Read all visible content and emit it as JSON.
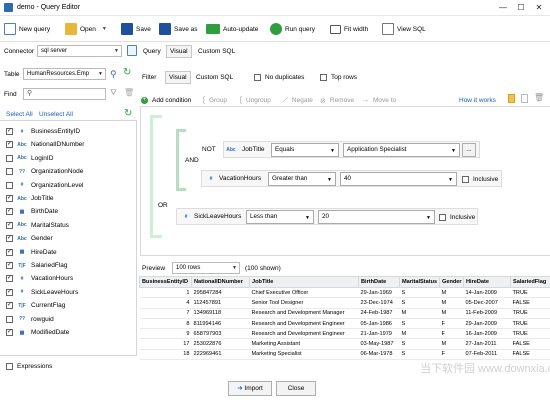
{
  "window": {
    "title": "demo - Query Editor",
    "controls": [
      "—",
      "☐",
      "✕"
    ]
  },
  "toolbar": {
    "new_query": "New query",
    "open": "Open",
    "save": "Save",
    "save_as": "Save as",
    "auto_update": "Auto-update",
    "run_query": "Run query",
    "fit_width": "Fit width",
    "view_sql": "View SQL"
  },
  "connector": {
    "label": "Connector",
    "value": "sql server",
    "query_label": "Query",
    "tabs": [
      "Visual",
      "Custom SQL"
    ]
  },
  "table": {
    "label": "Table",
    "value": "HumanResources.Emp",
    "find_label": "Find",
    "find_value": "",
    "select_all": "Select All",
    "unselect_all": "Unselect All"
  },
  "fields": [
    {
      "type": "#",
      "name": "BusinessEntityID",
      "checked": true
    },
    {
      "type": "Abc",
      "name": "NationalIDNumber",
      "checked": true
    },
    {
      "type": "Abc",
      "name": "LoginID",
      "checked": false
    },
    {
      "type": "??",
      "name": "OrganizationNode",
      "checked": false
    },
    {
      "type": "#",
      "name": "OrganizationLevel",
      "checked": false
    },
    {
      "type": "Abc",
      "name": "JobTitle",
      "checked": true
    },
    {
      "type": "▦",
      "name": "BirthDate",
      "checked": true
    },
    {
      "type": "Abc",
      "name": "MaritalStatus",
      "checked": true
    },
    {
      "type": "Abc",
      "name": "Gender",
      "checked": true
    },
    {
      "type": "▦",
      "name": "HireDate",
      "checked": true
    },
    {
      "type": "T|F",
      "name": "SalariedFlag",
      "checked": true
    },
    {
      "type": "#",
      "name": "VacationHours",
      "checked": true
    },
    {
      "type": "#",
      "name": "SickLeaveHours",
      "checked": true
    },
    {
      "type": "T|F",
      "name": "CurrentFlag",
      "checked": true
    },
    {
      "type": "??",
      "name": "rowguid",
      "checked": false
    },
    {
      "type": "▦",
      "name": "ModifiedDate",
      "checked": true
    }
  ],
  "expressions": "Expressions",
  "filter": {
    "label": "Filter",
    "tabs": [
      "Visual",
      "Custom SQL"
    ],
    "no_duplicates": "No duplicates",
    "top_rows": "Top rows",
    "actions": [
      "Add condition",
      "Group",
      "Ungroup",
      "Negate",
      "Remove",
      "Move to"
    ],
    "how_it_works": "How it works",
    "or_label": "OR",
    "and_label": "AND",
    "not_label": "NOT",
    "cond1": {
      "type": "Abc",
      "field": "JobTitle",
      "op": "Equals",
      "value": "Application Specialist",
      "more": "..."
    },
    "cond2": {
      "type": "#",
      "field": "VacationHours",
      "op": "Greater than",
      "value": "40",
      "inclusive": "Inclusive"
    },
    "cond3": {
      "type": "#",
      "field": "SickLeaveHours",
      "op": "Less than",
      "value": "20",
      "inclusive": "Inclusive"
    }
  },
  "preview": {
    "label": "Preview",
    "rows_select": "100 rows",
    "shown": "(100 shown)",
    "columns": [
      "BusinessEntityID",
      "NationalIDNumber",
      "JobTitle",
      "BirthDate",
      "MaritalStatus",
      "Gender",
      "HireDate",
      "SalariedFlag"
    ],
    "rows": [
      [
        "1",
        "295847284",
        "Chief Executive Officer",
        "29-Jan-1969",
        "S",
        "M",
        "14-Jan-2009",
        "TRUE"
      ],
      [
        "4",
        "112457891",
        "Senior Tool Designer",
        "23-Dec-1974",
        "S",
        "M",
        "05-Dec-2007",
        "FALSE"
      ],
      [
        "7",
        "134969118",
        "Research and Development Manager",
        "24-Feb-1987",
        "M",
        "M",
        "11-Feb-2009",
        "TRUE"
      ],
      [
        "8",
        "811994146",
        "Research and Development Engineer",
        "05-Jan-1986",
        "S",
        "F",
        "29-Jan-2009",
        "TRUE"
      ],
      [
        "9",
        "658797903",
        "Research and Development Engineer",
        "21-Jan-1979",
        "M",
        "F",
        "16-Jan-2009",
        "TRUE"
      ],
      [
        "17",
        "253022876",
        "Marketing Assistant",
        "03-May-1987",
        "S",
        "M",
        "27-Jan-2011",
        "FALSE"
      ],
      [
        "18",
        "222969461",
        "Marketing Specialist",
        "06-Mar-1978",
        "S",
        "F",
        "07-Feb-2011",
        "FALSE"
      ]
    ]
  },
  "buttons": {
    "import": "Import",
    "close": "Close"
  },
  "watermark": "当下软件园 www.downxia.com",
  "colors": {
    "accent": "#1a5fb4",
    "green": "#2e9e3e",
    "red_x": "#d14a3a",
    "bracket": "#b9ddc2",
    "or_bracket": "#ccefd2"
  }
}
